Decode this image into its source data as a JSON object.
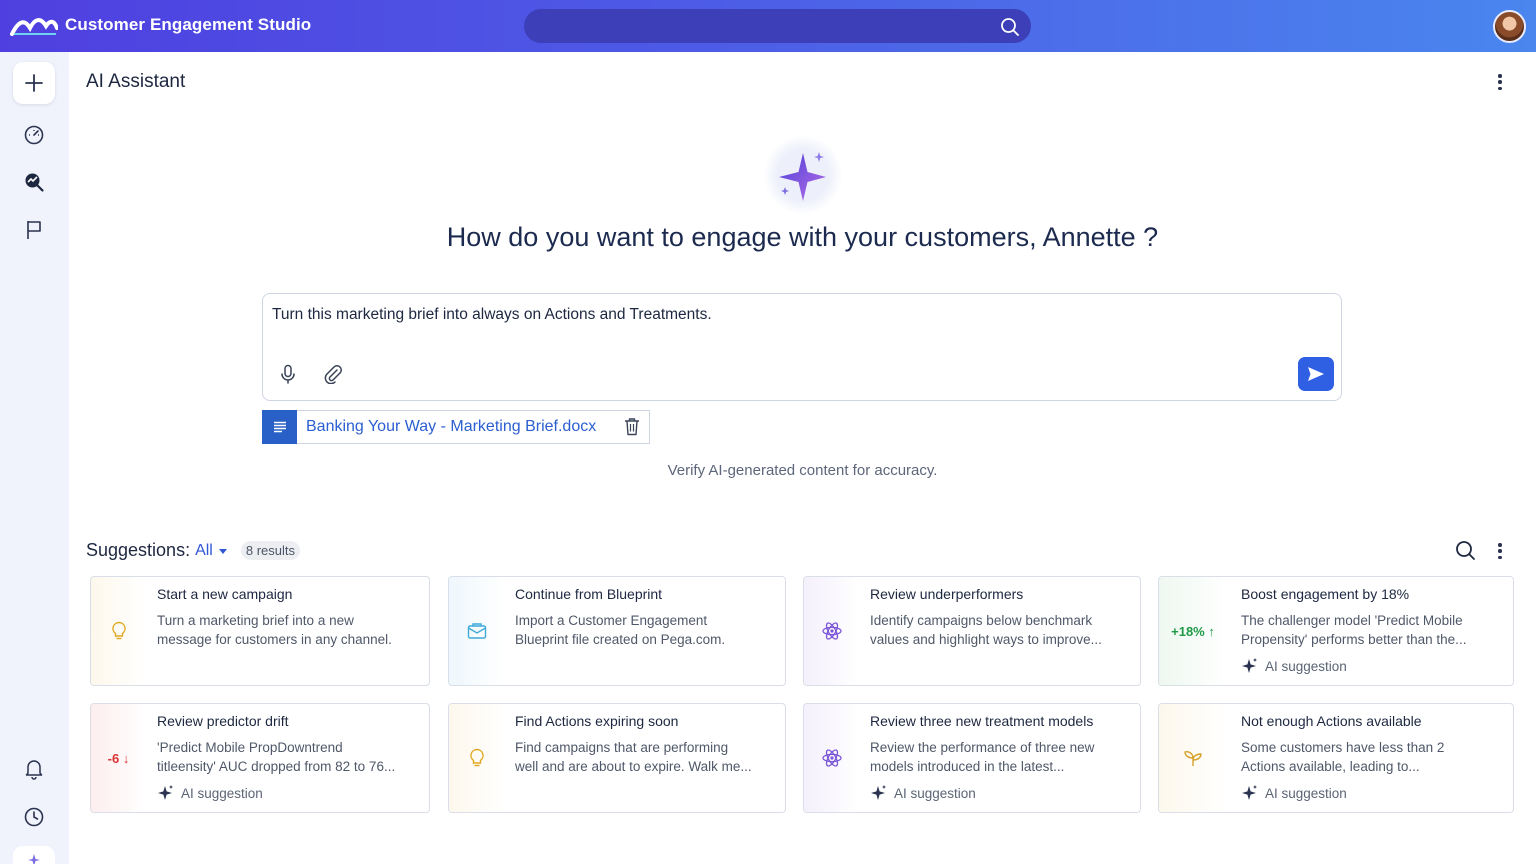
{
  "header": {
    "app_title": "Customer Engagement Studio"
  },
  "page": {
    "title": "AI Assistant"
  },
  "hero": {
    "headline": "How do you want to engage with your customers, Annette ?"
  },
  "prompt": {
    "text": "Turn this marketing brief into always on Actions and Treatments."
  },
  "attachment": {
    "file_name": "Banking Your Way - Marketing Brief.docx"
  },
  "disclaimer": "Verify AI-generated content for accuracy.",
  "suggestions": {
    "label": "Suggestions:",
    "filter": "All",
    "results": "8 results",
    "ai_tag": "AI suggestion",
    "cards": [
      {
        "title": "Start a new campaign",
        "desc1": "Turn a marketing brief into a new",
        "desc2": "message for customers in any channel.",
        "icon": "lightbulb-icon"
      },
      {
        "title": "Continue from Blueprint",
        "desc1": "Import a Customer Engagement",
        "desc2": "Blueprint file created on Pega.com.",
        "icon": "envelope-icon"
      },
      {
        "title": "Review underperformers",
        "desc1": "Identify campaigns below benchmark",
        "desc2": "values and highlight ways to improve...",
        "icon": "atom-icon"
      },
      {
        "title": "Boost engagement by 18%",
        "desc1": "The challenger model 'Predict Mobile",
        "desc2": "Propensity' performs better than the...",
        "metric": "+18% ↑"
      },
      {
        "title": "Review predictor drift",
        "desc1": "'Predict Mobile PropDowntrend",
        "desc2": "titleensity' AUC dropped from 82 to 76...",
        "metric": "-6 ↓"
      },
      {
        "title": "Find Actions expiring soon",
        "desc1": "Find campaigns that are performing",
        "desc2": "well and are about to expire. Walk me...",
        "icon": "lightbulb-icon"
      },
      {
        "title": "Review three new treatment models",
        "desc1": "Review the performance of three new",
        "desc2": "models introduced in the latest...",
        "icon": "atom-icon"
      },
      {
        "title": "Not enough Actions available",
        "desc1": "Some customers have less than 2",
        "desc2": "Actions available, leading to...",
        "icon": "sprout-icon"
      }
    ]
  },
  "colors": {
    "header_gradient_start": "#4f3fe0",
    "header_gradient_end": "#4a86ee",
    "accent": "#2f5fe3",
    "metric_up": "#1f9a48",
    "metric_down": "#d93232"
  }
}
